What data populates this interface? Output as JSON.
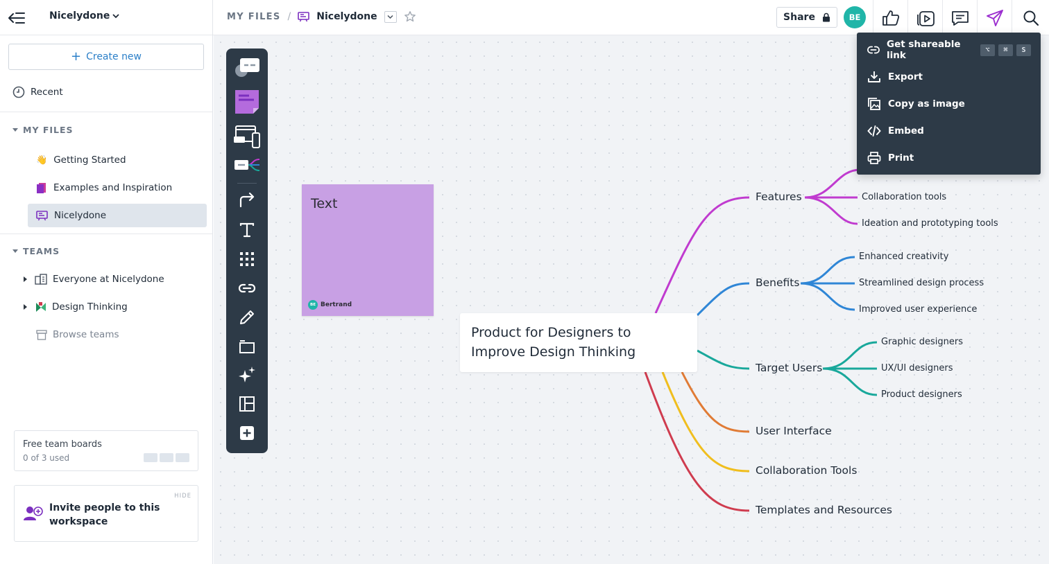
{
  "sidebar": {
    "workspace_name": "Nicelydone",
    "create_new": "Create new",
    "recent": "Recent",
    "my_files_heading": "MY FILES",
    "my_files": [
      {
        "emoji": "👋",
        "label": "Getting Started"
      },
      {
        "label": "Examples and Inspiration"
      },
      {
        "label": "Nicelydone"
      }
    ],
    "teams_heading": "TEAMS",
    "teams": [
      {
        "label": "Everyone at Nicelydone"
      },
      {
        "label": "Design Thinking"
      },
      {
        "label": "Browse teams"
      }
    ],
    "free_boards": {
      "title": "Free team boards",
      "usage": "0 of 3 used"
    },
    "invite": {
      "hide": "HIDE",
      "text": "Invite people to this workspace"
    }
  },
  "header": {
    "breadcrumb_root": "MY FILES",
    "breadcrumb_sep": "/",
    "file_name": "Nicelydone",
    "share_label": "Share",
    "avatar_initials": "BE"
  },
  "share_menu": {
    "items": [
      {
        "label": "Get shareable link",
        "shortcut": [
          "⌥",
          "⌘",
          "S"
        ]
      },
      {
        "label": "Export"
      },
      {
        "label": "Copy as image"
      },
      {
        "label": "Embed"
      },
      {
        "label": "Print"
      }
    ]
  },
  "sticky": {
    "text": "Text",
    "author": "Bertrand",
    "author_initials": "BE",
    "color": "#c8a0e4"
  },
  "mindmap": {
    "root": "Product for Designers to Improve Design Thinking",
    "branches": [
      {
        "label": "Features",
        "color": "#c03bcf",
        "children": [
          "Collaboration tools",
          "Ideation and prototyping tools"
        ]
      },
      {
        "label": "Benefits",
        "color": "#2f86d6",
        "children": [
          "Enhanced creativity",
          "Streamlined design process",
          "Improved user experience"
        ]
      },
      {
        "label": "Target Users",
        "color": "#19a89b",
        "children": [
          "Graphic designers",
          "UX/UI designers",
          "Product designers"
        ]
      },
      {
        "label": "User Interface",
        "color": "#e07b35",
        "children": []
      },
      {
        "label": "Collaboration Tools",
        "color": "#f0be1e",
        "children": []
      },
      {
        "label": "Templates and Resources",
        "color": "#cf3c4f",
        "children": []
      }
    ]
  },
  "colors": {
    "accent": "#2b7fc8",
    "toolbar_bg": "#2d3a47",
    "avatar": "#20b5a8",
    "brand_purple": "#7b2fbf"
  }
}
